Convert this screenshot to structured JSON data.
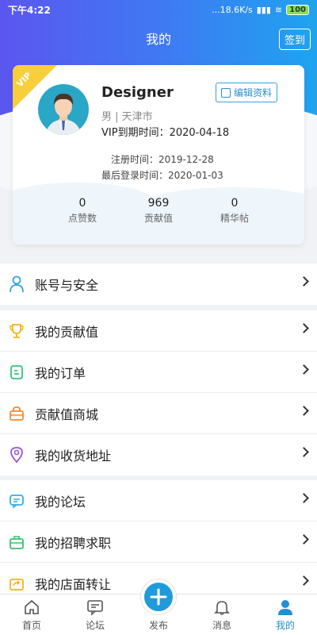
{
  "status_bar": {
    "time": "下午4:22",
    "speed": "...18.6K/s",
    "battery": "100"
  },
  "header": {
    "title": "我的",
    "signin_label": "签到"
  },
  "profile": {
    "vip_badge": "VIP",
    "name": "Designer",
    "gender_city": "男 | 天津市",
    "vip_expire": "VIP到期时间：2020-04-18",
    "edit_label": "编辑资料",
    "register_time": "注册时间：2019-12-28",
    "last_login": "最后登录时间：2020-01-03",
    "stats": [
      {
        "value": "0",
        "label": "点赞数"
      },
      {
        "value": "969",
        "label": "贡献值"
      },
      {
        "value": "0",
        "label": "精华帖"
      }
    ]
  },
  "menu": {
    "account": {
      "label": "账号与安全",
      "icon": "user-icon"
    },
    "group2": [
      {
        "label": "我的贡献值",
        "icon": "trophy-icon",
        "color": "#f2b31b"
      },
      {
        "label": "我的订单",
        "icon": "order-icon",
        "color": "#33c27a"
      },
      {
        "label": "贡献值商城",
        "icon": "shop-bag-icon",
        "color": "#f08a35"
      },
      {
        "label": "我的收货地址",
        "icon": "location-icon",
        "color": "#9b52d8"
      }
    ],
    "group3": [
      {
        "label": "我的论坛",
        "icon": "forum-icon",
        "color": "#34aee0"
      },
      {
        "label": "我的招聘求职",
        "icon": "briefcase-icon",
        "color": "#3bbf6e"
      },
      {
        "label": "我的店面转让",
        "icon": "transfer-icon",
        "color": "#f1b32a"
      }
    ]
  },
  "tabbar": {
    "tabs": [
      {
        "label": "首页",
        "icon": "home-icon"
      },
      {
        "label": "论坛",
        "icon": "forum-icon"
      },
      {
        "label": "发布",
        "icon": "plus-icon"
      },
      {
        "label": "消息",
        "icon": "bell-icon"
      },
      {
        "label": "我的",
        "icon": "person-icon"
      }
    ],
    "active_index": 4
  },
  "colors": {
    "accent": "#1f9bdc",
    "header_start": "#5b56f0",
    "header_end": "#1ea4ef",
    "vip": "#f7cf3a"
  }
}
